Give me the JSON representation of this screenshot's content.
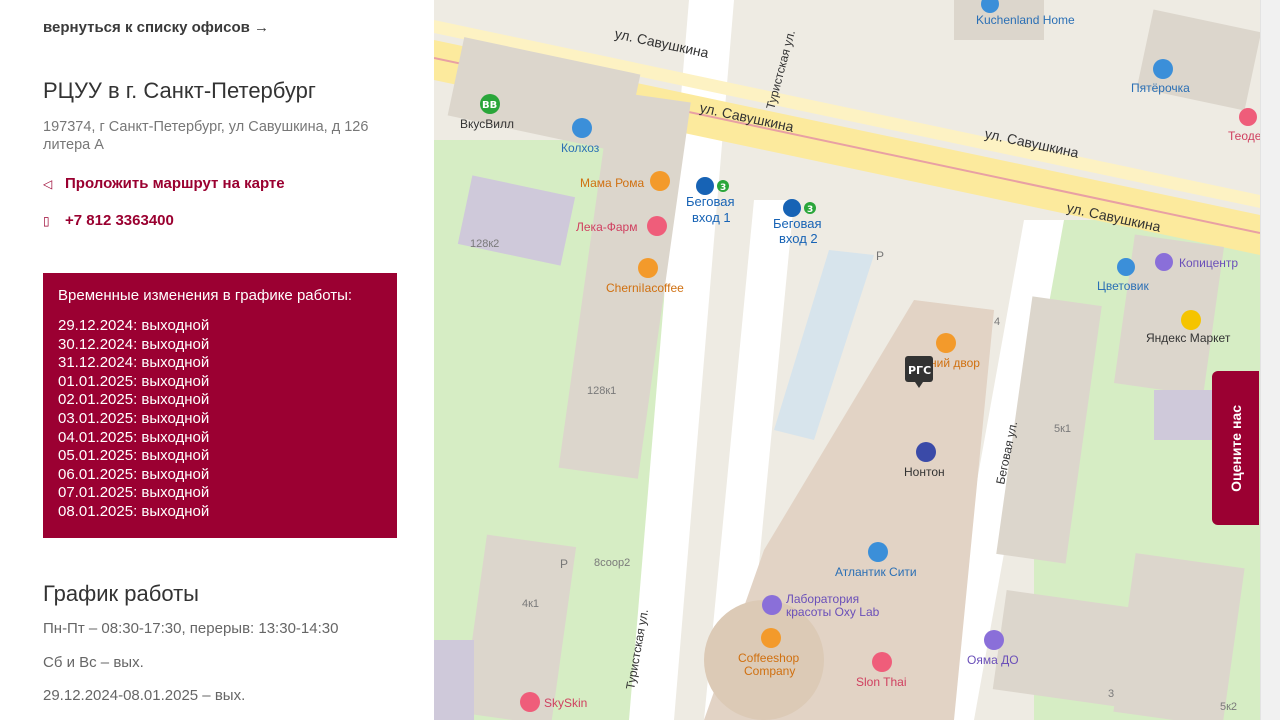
{
  "back_link": "вернуться к списку офисов →",
  "office": {
    "title": "РЦУУ в г. Санкт-Петербург",
    "address": "197374, г Санкт-Петербург, ул Савушкина, д 126 литера А",
    "route_link": "Проложить маршрут на карте",
    "phone": "+7 812 3363400"
  },
  "notice": {
    "title": "Временные изменения в графике работы:",
    "items": [
      "29.12.2024: выходной",
      "30.12.2024: выходной",
      "31.12.2024: выходной",
      "01.01.2025: выходной",
      "02.01.2025: выходной",
      "03.01.2025: выходной",
      "04.01.2025: выходной",
      "05.01.2025: выходной",
      "06.01.2025: выходной",
      "07.01.2025: выходной",
      "08.01.2025: выходной"
    ]
  },
  "schedule": {
    "title": "График работы",
    "lines": [
      "Пн-Пт – 08:30-17:30, перерыв: 13:30-14:30",
      "Сб и Вс – вых.",
      "29.12.2024-08.01.2025 – вых."
    ]
  },
  "rate_button": "Оцените нас",
  "map": {
    "streets": {
      "s1": "ул. Савушкина",
      "s2": "ул. Савушкина",
      "s3": "ул. Савушкина",
      "s4": "ул. Савушкина",
      "turist1": "Туристская ул.",
      "turist2": "Туристская ул.",
      "begovaya": "Беговая ул."
    },
    "pois": {
      "vkusvill": "ВкусВилл",
      "vkusvill_icon": "ВВ",
      "kolhoz": "Колхоз",
      "mamaroma": "Мама Рома",
      "lekafarm": "Лека-Фарм",
      "chernila": "CherniIacoffee",
      "metro1a": "Беговая",
      "metro1b": "вход 1",
      "metro2a": "Беговая",
      "metro2b": "вход 2",
      "metro_line": "3",
      "kuchenland": "Kuchenland Home",
      "pyaterochka": "Пятёрочка",
      "teodor": "Теоде",
      "kopicentr": "Копицентр",
      "cvetovik": "Цветовик",
      "yandex": "Яндекс Маркет",
      "dvor": "ний двор",
      "rgs": "РГС",
      "nonton": "Нонтон",
      "atlantic": "Атлантик Сити",
      "oxy1": "Лаборатория",
      "oxy2": "красоты Oxy Lab",
      "coffeeshop1": "Coffeeshop",
      "coffeeshop2": "Company",
      "slonthai": "Slon Thai",
      "oyama": "Ояма ДО",
      "skyskin": "SkySkin",
      "parking": "P"
    },
    "houses": {
      "h1": "128к2",
      "h2": "128к1",
      "h3": "8соор2",
      "h4": "4к1",
      "h5": "4",
      "h6": "5к1",
      "h7": "3",
      "h8": "5к2"
    },
    "colors": {
      "brand": "#9b0032",
      "road_yellow": "#fcea9d",
      "green": "#d8efc9",
      "building": "#dcd6cc",
      "metro": "#1763b5",
      "metro_line3": "#2aa63a"
    }
  }
}
